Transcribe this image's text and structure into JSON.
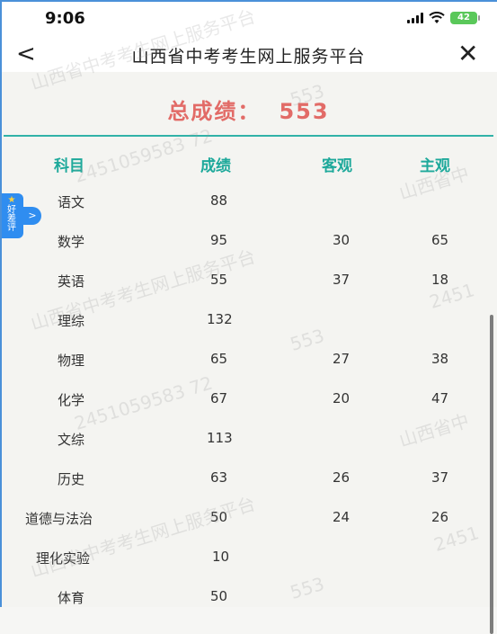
{
  "status_bar": {
    "time": "9:06",
    "battery": "42"
  },
  "nav": {
    "back_glyph": "<",
    "title": "山西省中考考生网上服务平台",
    "close_glyph": "✕"
  },
  "total": {
    "label": "总成绩：",
    "value": "553"
  },
  "table": {
    "headers": [
      "科目",
      "成绩",
      "客观",
      "主观"
    ],
    "rows": [
      {
        "subject": "语文",
        "score": "88",
        "objective": "",
        "subjective": ""
      },
      {
        "subject": "数学",
        "score": "95",
        "objective": "30",
        "subjective": "65"
      },
      {
        "subject": "英语",
        "score": "55",
        "objective": "37",
        "subjective": "18"
      },
      {
        "subject": "理综",
        "score": "132",
        "objective": "",
        "subjective": ""
      },
      {
        "subject": "物理",
        "score": "65",
        "objective": "27",
        "subjective": "38"
      },
      {
        "subject": "化学",
        "score": "67",
        "objective": "20",
        "subjective": "47"
      },
      {
        "subject": "文综",
        "score": "113",
        "objective": "",
        "subjective": ""
      },
      {
        "subject": "历史",
        "score": "63",
        "objective": "26",
        "subjective": "37"
      },
      {
        "subject": "道德与法治",
        "score": "50",
        "objective": "24",
        "subjective": "26"
      },
      {
        "subject": "理化实验",
        "score": "10",
        "objective": "",
        "subjective": ""
      },
      {
        "subject": "体育",
        "score": "50",
        "objective": "",
        "subjective": ""
      }
    ]
  },
  "side_badge": {
    "star": "★",
    "text1": "好",
    "text2": "差",
    "text3": "评",
    "arrow": ">"
  },
  "watermarks": {
    "platform": "山西省中考考生网上服务平台",
    "platform_short": "山西省中",
    "id": "2451059583 72",
    "id_short": "2451",
    "score": "553"
  },
  "colors": {
    "accent": "#1ea99b",
    "total": "#e26b67",
    "badge": "#2f8df0"
  }
}
